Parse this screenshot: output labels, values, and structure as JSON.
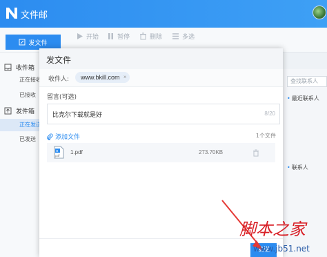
{
  "app": {
    "title": "文件邮"
  },
  "toolbar": {
    "send_label": "发文件",
    "tools": [
      {
        "label": "开始",
        "icon": "play-icon"
      },
      {
        "label": "暂停",
        "icon": "pause-icon"
      },
      {
        "label": "删除",
        "icon": "delete-icon"
      },
      {
        "label": "多选",
        "icon": "list-icon"
      }
    ]
  },
  "sidebar": {
    "inbox": {
      "label": "收件箱",
      "items": [
        {
          "label": "正在接收"
        },
        {
          "label": "已接收"
        }
      ]
    },
    "outbox": {
      "label": "发件箱",
      "items": [
        {
          "label": "正在发送"
        },
        {
          "label": "已发送"
        }
      ]
    }
  },
  "dialog": {
    "title": "发文件",
    "recipient_label": "收件人:",
    "recipient_chip": "www.bkill.com",
    "chip_close": "×",
    "message_label": "留言(可选)",
    "message_text": "比克尔下载就是好",
    "message_count": "8/20",
    "add_file_label": "添加文件",
    "file_count": "1个文件",
    "files": [
      {
        "name": "1.pdf",
        "size": "273.70KB"
      }
    ],
    "send_button": "发送"
  },
  "contacts": {
    "search_placeholder": "查找联系人",
    "recent_label": "最近联系人",
    "all_label": "联系人"
  },
  "watermark": {
    "text": "脚本之家",
    "url": "www.jb51.net"
  },
  "colors": {
    "accent": "#2c8cf0",
    "arrow": "#e53935"
  }
}
